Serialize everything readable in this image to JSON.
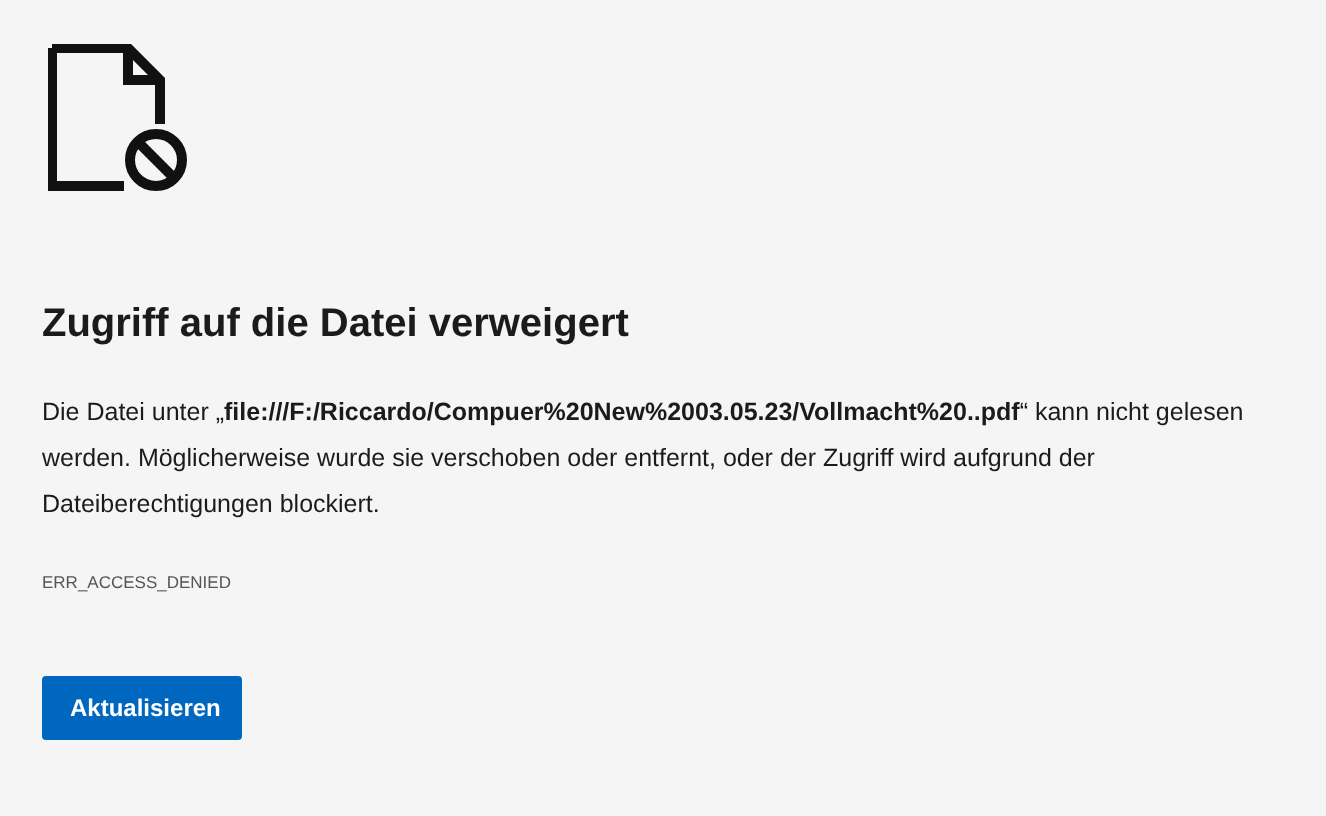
{
  "title": "Zugriff auf die Datei verweigert",
  "message": "Die Datei unter „**file:///F:/Riccardo/Compuer%20New%2003.05.23/Vollmacht%20..pdf**“ kann nicht gelesen werden. Möglicherweise wurde sie verschoben oder entfernt, oder der Zugriff wird aufgrund der Dateiberechtigungen blockiert.",
  "error_code": "ERR_ACCESS_DENIED",
  "button": "Aktualisieren"
}
